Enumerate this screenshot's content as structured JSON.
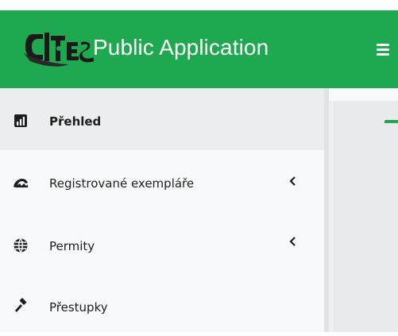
{
  "header": {
    "logo_text": "CITES",
    "app_title": "Public Application",
    "menu_icon": "hamburger-icon"
  },
  "sidebar": {
    "items": [
      {
        "label": "Přehled",
        "icon": "dashboard-icon",
        "active": true,
        "has_submenu": false
      },
      {
        "label": "Registrované exempláře",
        "icon": "animal-icon",
        "active": false,
        "has_submenu": true
      },
      {
        "label": "Permity",
        "icon": "globe-icon",
        "active": false,
        "has_submenu": true
      },
      {
        "label": "Přestupky",
        "icon": "gavel-icon",
        "active": false,
        "has_submenu": false
      }
    ]
  },
  "colors": {
    "brand_green": "#1ea84f",
    "sidebar_bg": "#f8f9fa",
    "active_bg": "#ebedef"
  }
}
